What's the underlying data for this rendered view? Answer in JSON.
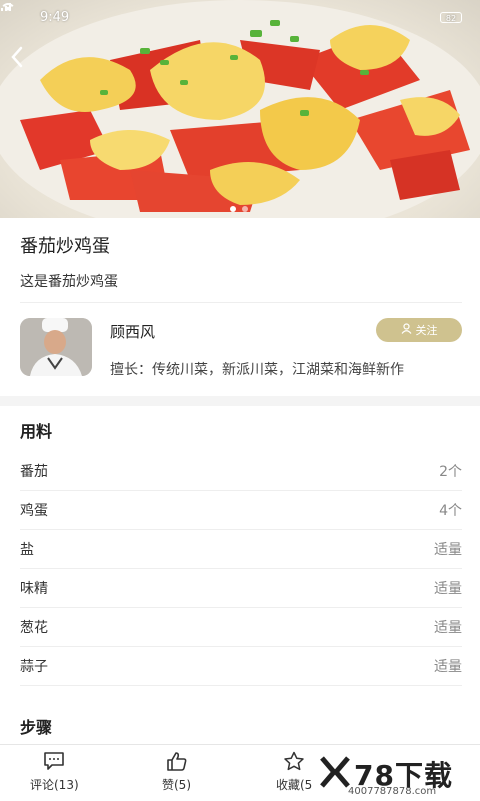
{
  "status_bar": {
    "time": "9:49",
    "battery": "82"
  },
  "recipe": {
    "title": "番茄炒鸡蛋",
    "description": "这是番茄炒鸡蛋"
  },
  "chef": {
    "name": "顾西风",
    "follow_label": "关注",
    "specialty": "擅长：传统川菜，新派川菜，江湖菜和海鲜新作"
  },
  "ingredients": {
    "section_title": "用料",
    "items": [
      {
        "name": "番茄",
        "qty": "2个"
      },
      {
        "name": "鸡蛋",
        "qty": "4个"
      },
      {
        "name": "盐",
        "qty": "适量"
      },
      {
        "name": "味精",
        "qty": "适量"
      },
      {
        "name": "葱花",
        "qty": "适量"
      },
      {
        "name": "蒜子",
        "qty": "适量"
      }
    ]
  },
  "steps": {
    "section_title": "步骤"
  },
  "bottom_bar": {
    "comment_label": "评论(13)",
    "like_label": "赞(5)",
    "favorite_label": "收藏(5"
  },
  "watermark": {
    "brand": "78下载",
    "phone": "4007787878.com"
  },
  "colors": {
    "accent": "#cfc28f",
    "tomato": "#e8412c",
    "egg": "#f3c94a"
  },
  "icons": {
    "back": "chevron-left-icon",
    "comment": "comment-icon",
    "like": "thumbs-up-icon",
    "favorite": "star-icon",
    "follow": "user-icon"
  }
}
